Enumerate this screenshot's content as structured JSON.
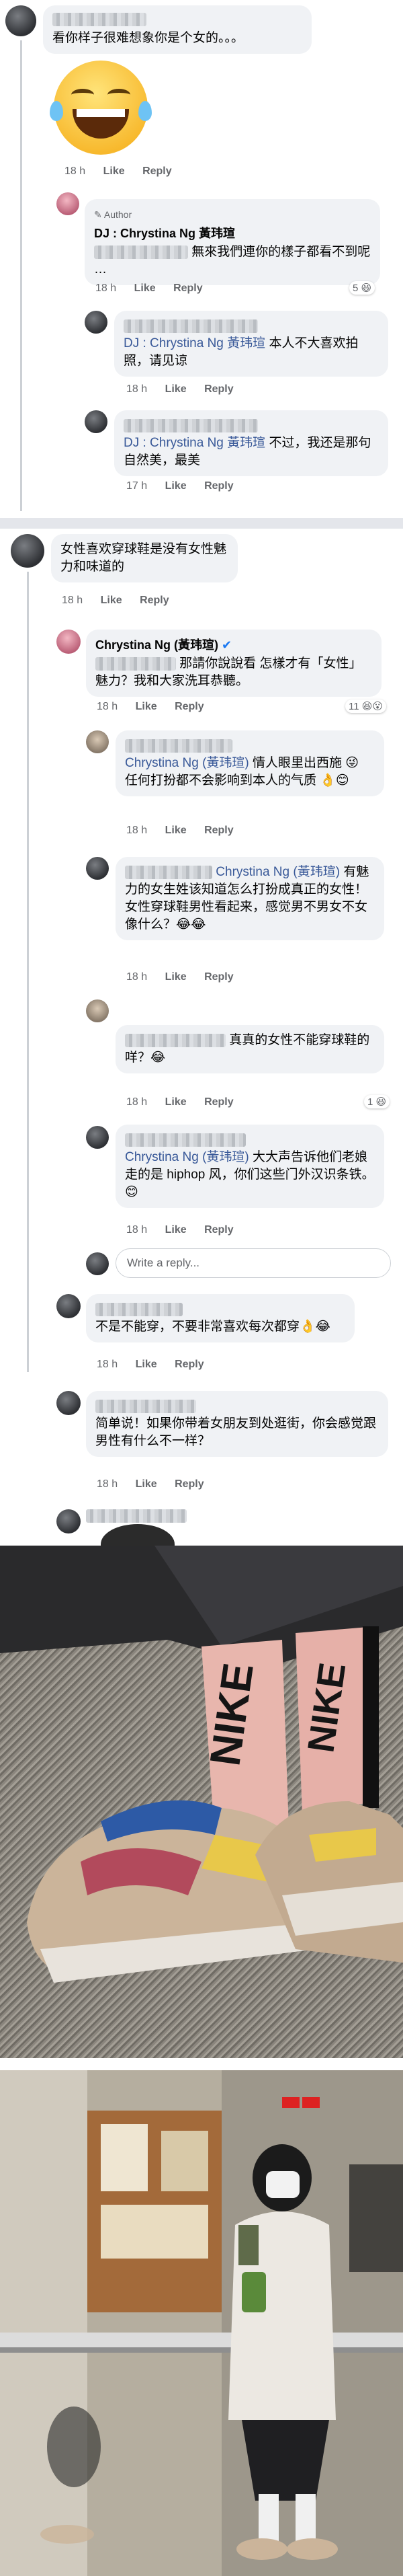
{
  "comments": [
    {
      "id": "c1",
      "text": "看你样子很难想象你是个女的。。。",
      "time": "18 h",
      "like": "Like",
      "reply": "Reply"
    },
    {
      "id": "r1",
      "author_badge": "Author",
      "name": "DJ : Chrystina Ng 黃玮瑄",
      "text": "無來我們連你的樣子都看不到呢 …",
      "time": "18 h",
      "like": "Like",
      "reply": "Reply",
      "reactions": "5"
    },
    {
      "id": "r2",
      "mention": "DJ : Chrystina Ng 黃玮瑄",
      "text": "本人不大喜欢拍照，请见谅",
      "time": "18 h",
      "like": "Like",
      "reply": "Reply"
    },
    {
      "id": "r3",
      "mention": "DJ : Chrystina Ng 黃玮瑄",
      "text": "不过，我还是那句自然美，最美",
      "time": "17 h",
      "like": "Like",
      "reply": "Reply"
    },
    {
      "id": "c2",
      "text": "女性喜欢穿球鞋是没有女性魅力和味道的",
      "time": "18 h",
      "like": "Like",
      "reply": "Reply"
    },
    {
      "id": "r4",
      "name": "Chrystina Ng (黃玮瑄)",
      "text": "那請你說說看 怎樣才有「女性」魅力？我和大家洗耳恭聽。",
      "time": "18 h",
      "like": "Like",
      "reply": "Reply",
      "reactions": "11"
    },
    {
      "id": "r5",
      "mention": "Chrystina Ng (黃玮瑄)",
      "text": "情人眼里出西施 😜 任何打扮都不会影响到本人的气质 👌😊",
      "time": "18 h",
      "like": "Like",
      "reply": "Reply"
    },
    {
      "id": "r6",
      "mention": "Chrystina Ng (黃玮瑄)",
      "text": "有魅力的女生姓该知道怎么打扮成真正的女性！女性穿球鞋男性看起来，感觉男不男女不女像什么？😂😂",
      "time": "18 h",
      "like": "Like",
      "reply": "Reply"
    },
    {
      "id": "r7",
      "text": "真真的女性不能穿球鞋的咩？😂",
      "time": "18 h",
      "like": "Like",
      "reply": "Reply",
      "reactions": "1"
    },
    {
      "id": "r8",
      "mention": "Chrystina Ng (黃玮瑄)",
      "text": "大大声告诉他们老娘走的是 hiphop 风，你们这些门外汉识条铁。😊",
      "time": "18 h",
      "like": "Like",
      "reply": "Reply"
    },
    {
      "id": "c3",
      "text": "不是不能穿，不要非常喜欢每次都穿👌😂",
      "time": "18 h",
      "like": "Like",
      "reply": "Reply"
    },
    {
      "id": "c4",
      "text": "简单说！如果你带着女朋友到处逛街，你会感觉跟男性有什么不一样？",
      "time": "18 h",
      "like": "Like",
      "reply": "Reply"
    }
  ],
  "write_reply_placeholder": "Write a reply...",
  "photo1_text": "NIKE NIKE",
  "icons": {
    "laugh": "laughing-tears-emoji",
    "reaction": "laugh-reaction-icon",
    "avatar": "user-avatar"
  },
  "colors": {
    "bubble": "#f0f2f5",
    "meta": "#65676b",
    "mention": "#385898",
    "divider": "#e4e6eb"
  }
}
